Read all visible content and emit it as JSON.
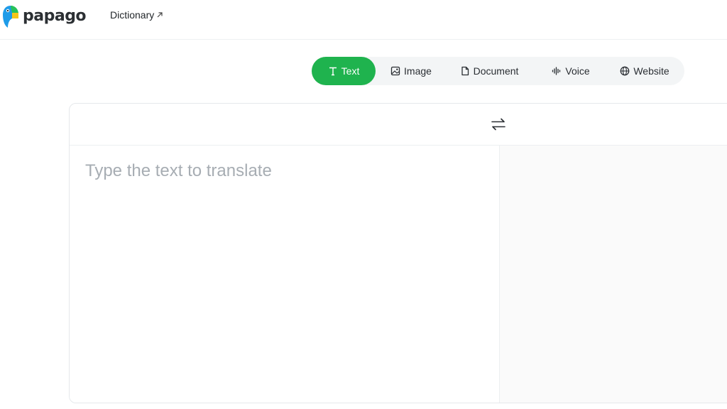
{
  "header": {
    "logo_text": "papago",
    "dictionary_link": "Dictionary"
  },
  "modes": {
    "tabs": [
      {
        "label": "Text",
        "icon": "text-icon",
        "active": true
      },
      {
        "label": "Image",
        "icon": "image-icon",
        "active": false
      },
      {
        "label": "Document",
        "icon": "document-icon",
        "active": false
      },
      {
        "label": "Voice",
        "icon": "voice-icon",
        "active": false
      },
      {
        "label": "Website",
        "icon": "globe-icon",
        "active": false
      }
    ]
  },
  "translator": {
    "source_placeholder": "Type the text to translate",
    "source_value": "",
    "swap_icon": "swap-icon"
  },
  "colors": {
    "accent": "#1fb34e",
    "logo_blue": "#1e9be8",
    "logo_green": "#27c25a",
    "logo_yellow": "#f5c518"
  }
}
